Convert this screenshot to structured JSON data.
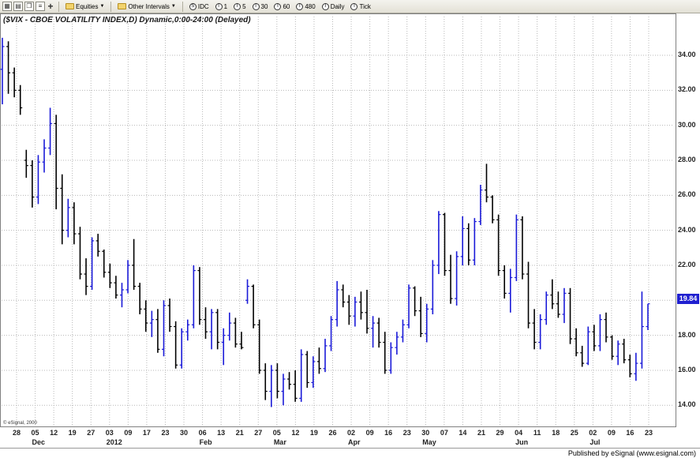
{
  "toolbar": {
    "equities_label": "Equities",
    "other_intervals_label": "Other Intervals",
    "intervals": [
      {
        "icon": "S",
        "label": "IDC"
      },
      {
        "icon": "I",
        "label": "1"
      },
      {
        "icon": "I",
        "label": "5"
      },
      {
        "icon": "I",
        "label": "30"
      },
      {
        "icon": "I",
        "label": "60"
      },
      {
        "icon": "I",
        "label": "480"
      },
      {
        "icon": "I",
        "label": "Daily"
      },
      {
        "icon": "I",
        "label": "Tick"
      }
    ]
  },
  "chart": {
    "title": "($VIX - CBOE VOLATILITY INDEX,D) Dynamic,0:00-24:00 (Delayed)",
    "watermark": "© eSignal, 2000",
    "last_value": "19.84",
    "last_badge_color": "#2020d0",
    "up_color": "#1a1ad8",
    "down_color": "#000000"
  },
  "status": {
    "published": "Published by eSignal (www.esignal.com)"
  },
  "chart_data": {
    "type": "ohlc-bar",
    "y_ticks": [
      "14.00",
      "16.00",
      "18.00",
      "20.00",
      "22.00",
      "24.00",
      "26.00",
      "28.00",
      "30.00",
      "32.00",
      "34.00"
    ],
    "ylim": [
      13.2,
      35.4
    ],
    "x_day_labels": [
      "28",
      "05",
      "12",
      "19",
      "27",
      "03",
      "09",
      "17",
      "23",
      "30",
      "06",
      "13",
      "21",
      "27",
      "05",
      "12",
      "19",
      "26",
      "02",
      "09",
      "16",
      "23",
      "30",
      "07",
      "14",
      "21",
      "29",
      "04",
      "11",
      "18",
      "25",
      "02",
      "09",
      "16",
      "23"
    ],
    "x_month_labels": [
      {
        "label": "Dec",
        "at_day": 1
      },
      {
        "label": "2012",
        "at_day": 5
      },
      {
        "label": "Feb",
        "at_day": 10
      },
      {
        "label": "Mar",
        "at_day": 14
      },
      {
        "label": "Apr",
        "at_day": 18
      },
      {
        "label": "May",
        "at_day": 22
      },
      {
        "label": "Jun",
        "at_day": 27
      },
      {
        "label": "Jul",
        "at_day": 31
      }
    ],
    "bars": [
      [
        33.2,
        35.0,
        31.2,
        34.5
      ],
      [
        34.5,
        34.8,
        31.8,
        33.0
      ],
      [
        33.0,
        33.3,
        31.6,
        32.0
      ],
      [
        32.0,
        32.3,
        30.6,
        31.0
      ],
      [
        28.0,
        28.6,
        27.0,
        27.7
      ],
      [
        27.7,
        28.0,
        25.3,
        25.9
      ],
      [
        25.9,
        28.3,
        25.5,
        27.9
      ],
      [
        27.9,
        29.2,
        27.3,
        28.7
      ],
      [
        28.7,
        31.0,
        28.3,
        30.1
      ],
      [
        30.1,
        30.6,
        25.2,
        26.4
      ],
      [
        26.4,
        27.2,
        23.2,
        24.0
      ],
      [
        24.0,
        25.8,
        23.6,
        25.3
      ],
      [
        25.3,
        25.6,
        23.2,
        23.8
      ],
      [
        23.8,
        24.2,
        21.2,
        21.5
      ],
      [
        21.5,
        22.4,
        20.3,
        20.8
      ],
      [
        20.8,
        23.6,
        20.6,
        23.4
      ],
      [
        23.4,
        23.8,
        22.5,
        22.8
      ],
      [
        22.8,
        22.9,
        21.3,
        21.6
      ],
      [
        21.6,
        22.1,
        20.7,
        21.0
      ],
      [
        21.0,
        21.4,
        20.1,
        20.3
      ],
      [
        20.3,
        21.0,
        19.6,
        20.6
      ],
      [
        20.6,
        22.3,
        20.4,
        22.0
      ],
      [
        22.0,
        23.5,
        20.6,
        20.8
      ],
      [
        20.8,
        21.0,
        19.2,
        19.5
      ],
      [
        19.5,
        20.0,
        18.2,
        18.7
      ],
      [
        18.7,
        19.4,
        17.9,
        18.9
      ],
      [
        18.9,
        19.5,
        17.0,
        17.2
      ],
      [
        17.2,
        20.0,
        16.8,
        19.7
      ],
      [
        19.7,
        20.1,
        18.2,
        18.5
      ],
      [
        18.5,
        18.8,
        16.1,
        16.3
      ],
      [
        16.3,
        18.4,
        16.1,
        18.2
      ],
      [
        18.2,
        18.9,
        17.7,
        18.6
      ],
      [
        18.6,
        22.0,
        18.4,
        21.7
      ],
      [
        21.7,
        21.9,
        18.6,
        18.9
      ],
      [
        18.9,
        19.6,
        17.8,
        18.2
      ],
      [
        18.2,
        19.5,
        17.2,
        19.3
      ],
      [
        19.3,
        19.5,
        17.2,
        17.6
      ],
      [
        17.6,
        18.4,
        16.3,
        18.0
      ],
      [
        18.0,
        19.3,
        17.7,
        18.7
      ],
      [
        18.7,
        19.0,
        17.3,
        17.5
      ],
      [
        17.5,
        18.2,
        17.2,
        17.3
      ],
      [
        20.0,
        21.2,
        19.8,
        20.8
      ],
      [
        20.8,
        20.9,
        18.4,
        18.6
      ],
      [
        18.6,
        18.9,
        15.8,
        16.0
      ],
      [
        16.0,
        16.4,
        14.3,
        14.8
      ],
      [
        14.8,
        16.3,
        13.9,
        16.0
      ],
      [
        16.0,
        16.4,
        14.4,
        14.8
      ],
      [
        14.8,
        15.8,
        14.0,
        15.5
      ],
      [
        15.5,
        15.9,
        14.9,
        15.2
      ],
      [
        15.2,
        16.0,
        14.2,
        14.4
      ],
      [
        14.4,
        17.2,
        14.2,
        16.9
      ],
      [
        16.9,
        17.1,
        15.0,
        15.3
      ],
      [
        15.3,
        16.8,
        15.0,
        16.5
      ],
      [
        16.5,
        17.3,
        15.8,
        16.1
      ],
      [
        16.1,
        17.8,
        15.9,
        17.4
      ],
      [
        17.4,
        19.1,
        17.1,
        18.9
      ],
      [
        18.9,
        21.1,
        18.5,
        20.6
      ],
      [
        20.6,
        20.9,
        19.6,
        19.9
      ],
      [
        19.9,
        20.3,
        18.6,
        19.1
      ],
      [
        19.1,
        20.2,
        18.5,
        19.9
      ],
      [
        19.9,
        20.5,
        18.9,
        19.3
      ],
      [
        19.3,
        20.6,
        18.1,
        18.4
      ],
      [
        18.4,
        19.1,
        17.3,
        18.7
      ],
      [
        18.7,
        19.0,
        17.3,
        17.6
      ],
      [
        17.6,
        18.2,
        15.8,
        16.0
      ],
      [
        16.0,
        17.6,
        15.8,
        17.3
      ],
      [
        17.3,
        18.2,
        16.9,
        17.9
      ],
      [
        17.9,
        18.9,
        17.6,
        18.6
      ],
      [
        18.6,
        20.9,
        18.4,
        20.7
      ],
      [
        20.7,
        20.8,
        19.1,
        19.4
      ],
      [
        19.4,
        20.2,
        17.9,
        18.1
      ],
      [
        18.1,
        19.8,
        17.6,
        19.5
      ],
      [
        19.5,
        22.3,
        19.2,
        22.0
      ],
      [
        22.0,
        25.1,
        21.5,
        24.9
      ],
      [
        24.9,
        25.0,
        21.4,
        21.7
      ],
      [
        21.7,
        22.6,
        19.8,
        20.1
      ],
      [
        20.1,
        22.8,
        19.7,
        22.5
      ],
      [
        22.5,
        24.8,
        22.0,
        24.1
      ],
      [
        24.1,
        24.4,
        22.0,
        22.3
      ],
      [
        22.3,
        24.7,
        22.0,
        24.5
      ],
      [
        24.5,
        26.6,
        24.3,
        26.3
      ],
      [
        26.3,
        27.8,
        25.6,
        25.9
      ],
      [
        25.9,
        26.0,
        24.4,
        24.6
      ],
      [
        24.6,
        24.9,
        21.4,
        21.7
      ],
      [
        21.7,
        22.0,
        20.1,
        20.4
      ],
      [
        20.4,
        21.8,
        19.3,
        21.3
      ],
      [
        21.3,
        24.9,
        21.1,
        24.6
      ],
      [
        24.6,
        24.8,
        21.2,
        21.5
      ],
      [
        21.5,
        22.2,
        18.4,
        18.7
      ],
      [
        18.7,
        19.5,
        17.2,
        17.6
      ],
      [
        17.6,
        19.2,
        17.2,
        18.9
      ],
      [
        18.9,
        20.5,
        18.6,
        20.3
      ],
      [
        20.3,
        21.2,
        19.5,
        19.8
      ],
      [
        19.8,
        20.5,
        19.0,
        19.2
      ],
      [
        19.2,
        20.7,
        18.7,
        20.4
      ],
      [
        20.4,
        20.7,
        17.5,
        17.8
      ],
      [
        17.8,
        18.4,
        16.8,
        17.0
      ],
      [
        17.0,
        17.4,
        16.2,
        16.4
      ],
      [
        16.4,
        18.5,
        16.3,
        18.2
      ],
      [
        18.2,
        18.6,
        17.1,
        17.4
      ],
      [
        17.4,
        19.2,
        17.1,
        18.9
      ],
      [
        18.9,
        19.3,
        17.6,
        17.9
      ],
      [
        17.9,
        18.0,
        16.6,
        16.8
      ],
      [
        16.8,
        17.7,
        16.3,
        17.5
      ],
      [
        17.5,
        17.8,
        16.4,
        16.6
      ],
      [
        16.6,
        16.9,
        15.6,
        15.8
      ],
      [
        15.8,
        17.0,
        15.4,
        16.4
      ],
      [
        16.4,
        20.5,
        16.1,
        18.5
      ],
      [
        18.5,
        19.8,
        18.3,
        19.8
      ]
    ]
  }
}
